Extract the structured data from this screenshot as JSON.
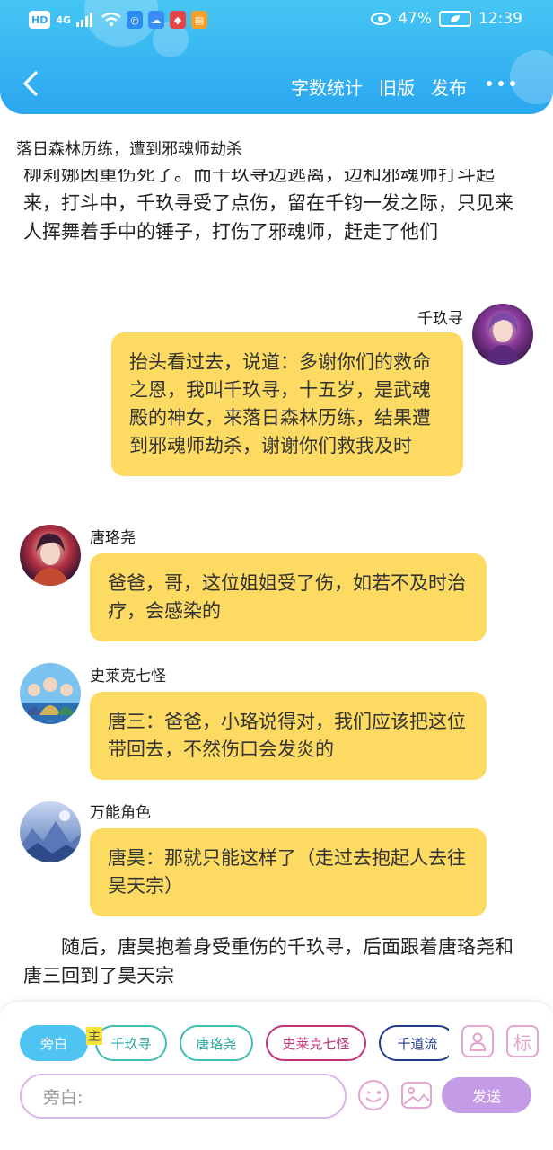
{
  "status_bar": {
    "hd": "HD",
    "network": "4G",
    "battery": "47%",
    "time": "12:39"
  },
  "nav": {
    "actions": [
      "字数统计",
      "旧版",
      "发布"
    ]
  },
  "chapter_title": "落日森林历练，遭到邪魂师劫杀",
  "narration_top": "柳莉娜因重伤死了。而千玖寻边逃离，边和邪魂师打斗起来，打斗中，千玖寻受了点伤，留在千钧一发之际，只见来人挥舞着手中的锤子，打伤了邪魂师，赶走了他们",
  "messages": [
    {
      "name": "千玖寻",
      "text": "抬头看过去，说道：多谢你们的救命之恩，我叫千玖寻，十五岁，是武魂殿的神女，来落日森林历练，结果遭到邪魂师劫杀，谢谢你们救我及时",
      "side": "right"
    },
    {
      "name": "唐珞尧",
      "text": "爸爸，哥，这位姐姐受了伤，如若不及时治疗，会感染的",
      "side": "left"
    },
    {
      "name": "史莱克七怪",
      "text": "唐三：爸爸，小珞说得对，我们应该把这位带回去，不然伤口会发炎的",
      "side": "left"
    },
    {
      "name": "万能角色",
      "text": "唐昊：那就只能这样了（走过去抱起人去往昊天宗）",
      "side": "left"
    }
  ],
  "narration_bottom": "随后，唐昊抱着身受重伤的千玖寻，后面跟着唐珞尧和唐三回到了昊天宗",
  "panel": {
    "chips": [
      "旁白",
      "千玖寻",
      "唐珞尧",
      "史莱克七怪",
      "千道流"
    ],
    "main_tag": "主",
    "mark_icon_label": "标",
    "input_placeholder": "旁白:",
    "send_label": "发送"
  },
  "colors": {
    "header": "#2ba7f0",
    "bubble": "#fddb63",
    "chip_selected": "#4fc3f2",
    "send": "#c49be6"
  }
}
